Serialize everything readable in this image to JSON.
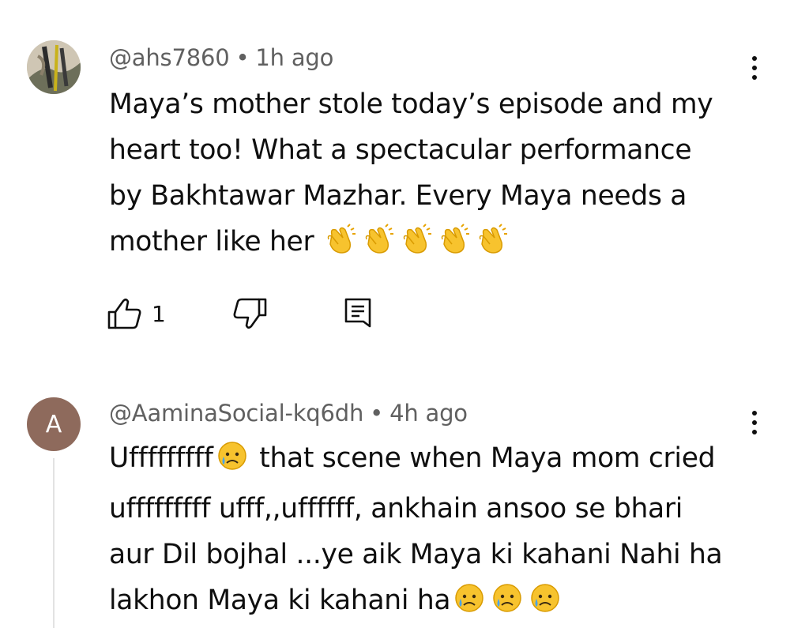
{
  "comments": [
    {
      "author": "@ahs7860",
      "time": "1h ago",
      "separator": "•",
      "avatar": "photo-avatar",
      "text_lines": [
        "Maya’s mother stole today’s episode and my",
        "heart too! What a spectacular performance",
        "by Bakhtawar Mazhar. Every Maya needs a",
        "mother like her "
      ],
      "trailing_emoji": [
        "clapping-hands-emoji",
        "clapping-hands-emoji",
        "clapping-hands-emoji",
        "clapping-hands-emoji",
        "clapping-hands-emoji"
      ],
      "likes": "1",
      "icons": [
        "thumb-up-icon",
        "thumb-down-icon",
        "reply-icon",
        "more-vertical-icon"
      ]
    },
    {
      "author": "@AaminaSocial-kq6dh",
      "time": "4h ago",
      "separator": "•",
      "avatar_letter": "A",
      "avatar_color": "#8e6a5c",
      "line1_start": "Ufffffffff",
      "line1_end": " that scene when Maya mom cried",
      "line2": "ufffffffff ufff,,uffffff, ankhain ansoo se bhari",
      "line3": "aur Dil bojhal ...ye aik Maya ki kahani Nahi ha",
      "line4": "lakhon Maya ki kahani ha",
      "emojis": [
        "crying-face-emoji",
        "crying-face-emoji",
        "crying-face-emoji",
        "crying-face-emoji"
      ],
      "icons": [
        "more-vertical-icon"
      ]
    }
  ]
}
